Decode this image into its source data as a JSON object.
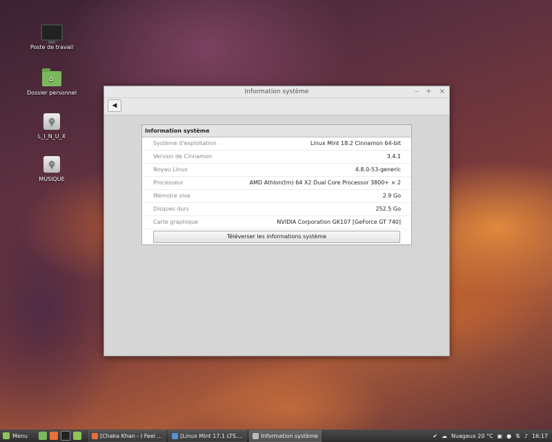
{
  "desktop": {
    "icons": [
      {
        "label": "Poste de travail"
      },
      {
        "label": "Dossier personnel"
      },
      {
        "label": "L_I_N_U_X"
      },
      {
        "label": "MUSIQUE"
      }
    ]
  },
  "window": {
    "title": "Information système",
    "controls": {
      "minimize": "–",
      "maximize": "+",
      "close": "×"
    },
    "back_icon": "◀"
  },
  "panel": {
    "header": "Information système",
    "rows": [
      {
        "label": "Système d'exploitation",
        "value": "Linux Mint 18.2 Cinnamon 64-bit"
      },
      {
        "label": "Version de Cinnamon",
        "value": "3.4.1"
      },
      {
        "label": "Noyau Linux",
        "value": "4.8.0-53-generic"
      },
      {
        "label": "Processeur",
        "value": "AMD Athlon(tm) 64 X2 Dual Core Processor 3800+ × 2"
      },
      {
        "label": "Mémoire vive",
        "value": "2.9 Go"
      },
      {
        "label": "Disques durs",
        "value": "252.5 Go"
      },
      {
        "label": "Carte graphique",
        "value": "NVIDIA Corporation GK107 [GeForce GT 740]"
      }
    ],
    "upload_button": "Téléverser les informations système"
  },
  "taskbar": {
    "menu_label": "Menu",
    "tasks": [
      {
        "label": "[Chaka Khan - I Feel ..."
      },
      {
        "label": "[Linux Mint 17.1 LTS...."
      },
      {
        "label": "Information système"
      }
    ],
    "weather": "Nuageux 20 °C",
    "clock": "16:17"
  },
  "colors": {
    "mint_green": "#8fc35a",
    "folder_green": "#7ab85b",
    "window_bg": "#d6d6d6"
  }
}
